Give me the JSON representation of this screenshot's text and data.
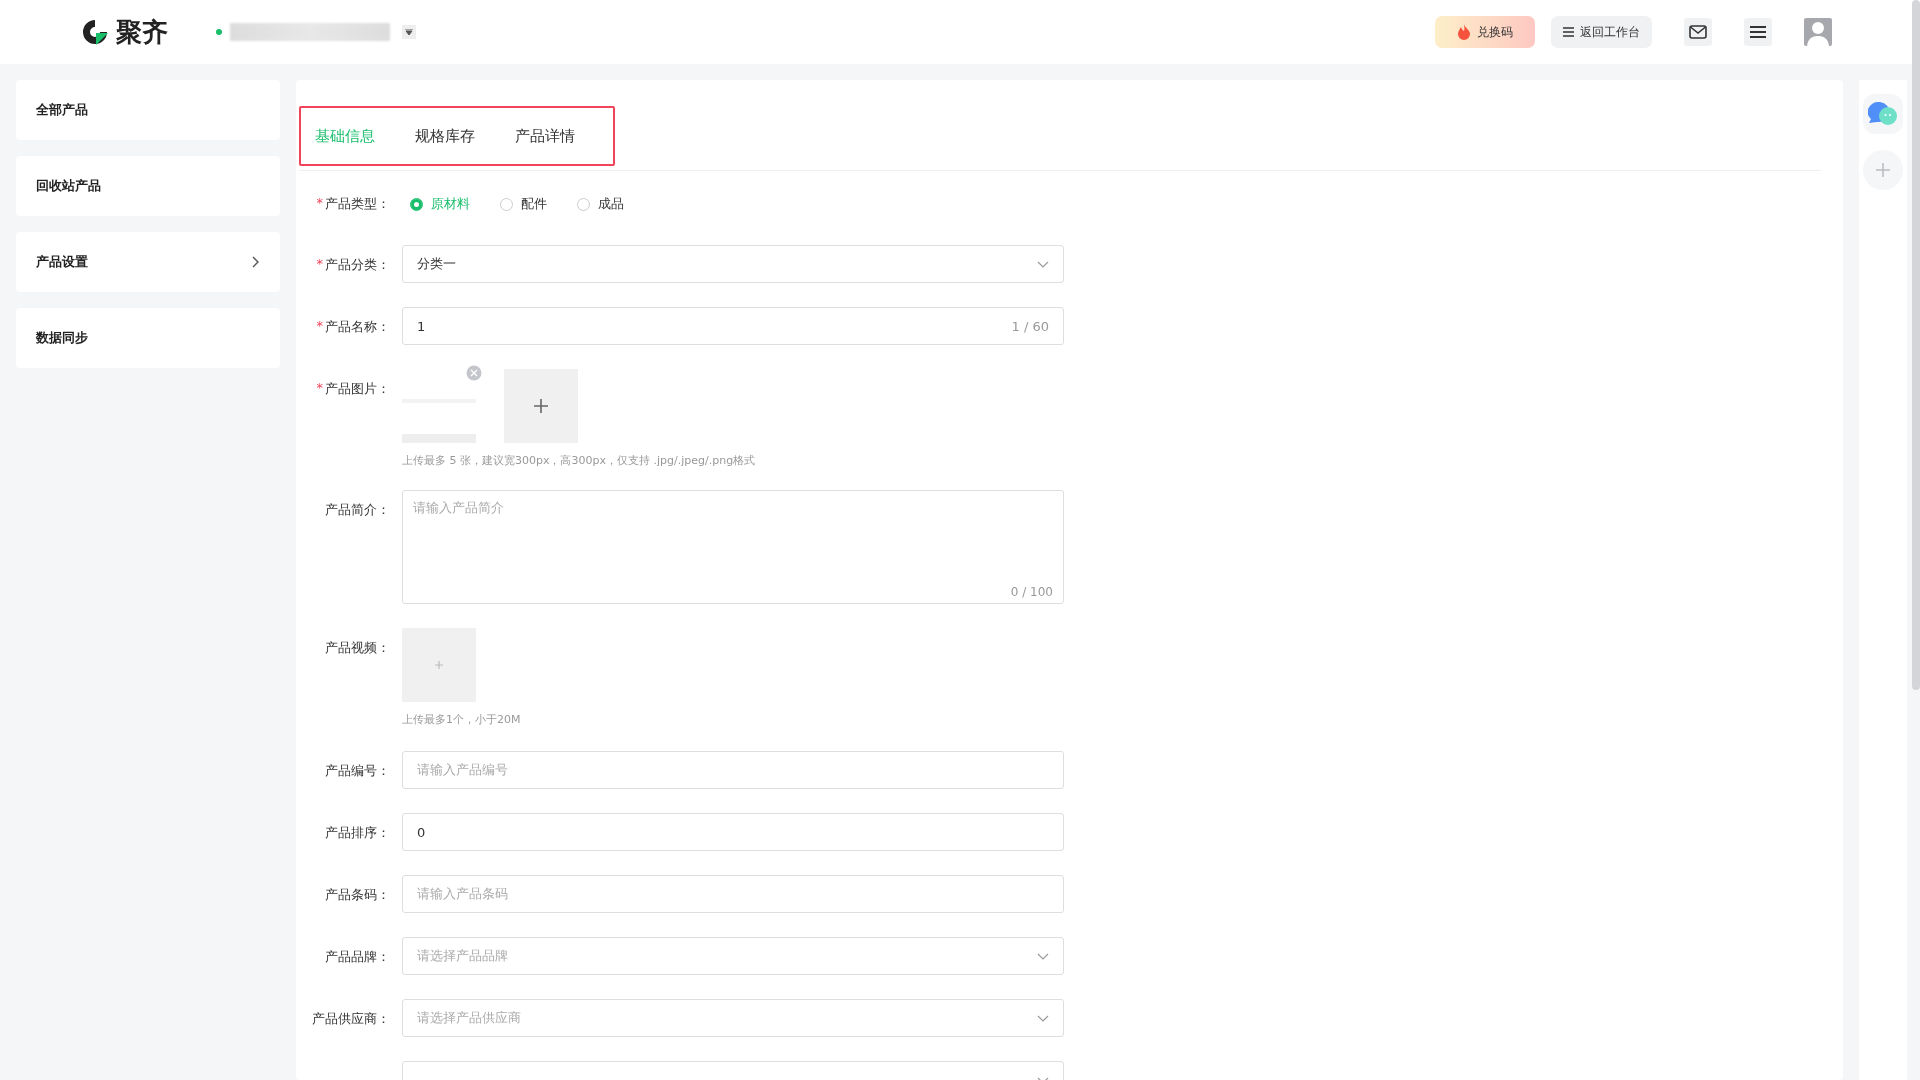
{
  "header": {
    "logo_text": "聚齐",
    "buttons": [
      {
        "kind": "promo",
        "label": "兑换码"
      },
      {
        "kind": "workbench",
        "label": "返回工作台"
      }
    ]
  },
  "sidebar": {
    "items": [
      {
        "label": "全部产品",
        "expandable": false
      },
      {
        "label": "回收站产品",
        "expandable": false
      },
      {
        "label": "产品设置",
        "expandable": true
      },
      {
        "label": "数据同步",
        "expandable": false
      }
    ]
  },
  "tabs": [
    {
      "label": "基础信息",
      "selected": true
    },
    {
      "label": "规格库存",
      "selected": false
    },
    {
      "label": "产品详情",
      "selected": false
    }
  ],
  "form": [
    {
      "kind": "radio",
      "label": "产品类型：",
      "required_mark": "*",
      "options": [
        {
          "label": "原材料",
          "selected": true
        },
        {
          "label": "配件",
          "selected": false
        },
        {
          "label": "成品",
          "selected": false
        }
      ]
    },
    {
      "kind": "select",
      "label": "产品分类：",
      "required_mark": "*",
      "value": "分类一"
    },
    {
      "kind": "input",
      "label": "产品名称：",
      "required_mark": "*",
      "value": "1",
      "counter": "1 / 60"
    },
    {
      "kind": "images",
      "label": "产品图片：",
      "required_mark": "*",
      "hint": "上传最多 5 张，建议宽300px，高300px，仅支持 .jpg/.jpeg/.png格式"
    },
    {
      "kind": "textarea",
      "label": "产品简介：",
      "placeholder": "请输入产品简介",
      "counter": "0 / 100"
    },
    {
      "kind": "video",
      "label": "产品视频：",
      "hint": "上传最多1个，小于20M"
    },
    {
      "kind": "input",
      "label": "产品编号：",
      "placeholder": "请输入产品编号"
    },
    {
      "kind": "input",
      "label": "产品排序：",
      "value": "0"
    },
    {
      "kind": "input",
      "label": "产品条码：",
      "placeholder": "请输入产品条码"
    },
    {
      "kind": "select",
      "label": "产品品牌：",
      "placeholder": "请选择产品品牌"
    },
    {
      "kind": "select",
      "label": "产品供应商：",
      "placeholder": "请选择产品供应商"
    },
    {
      "kind": "select"
    }
  ]
}
